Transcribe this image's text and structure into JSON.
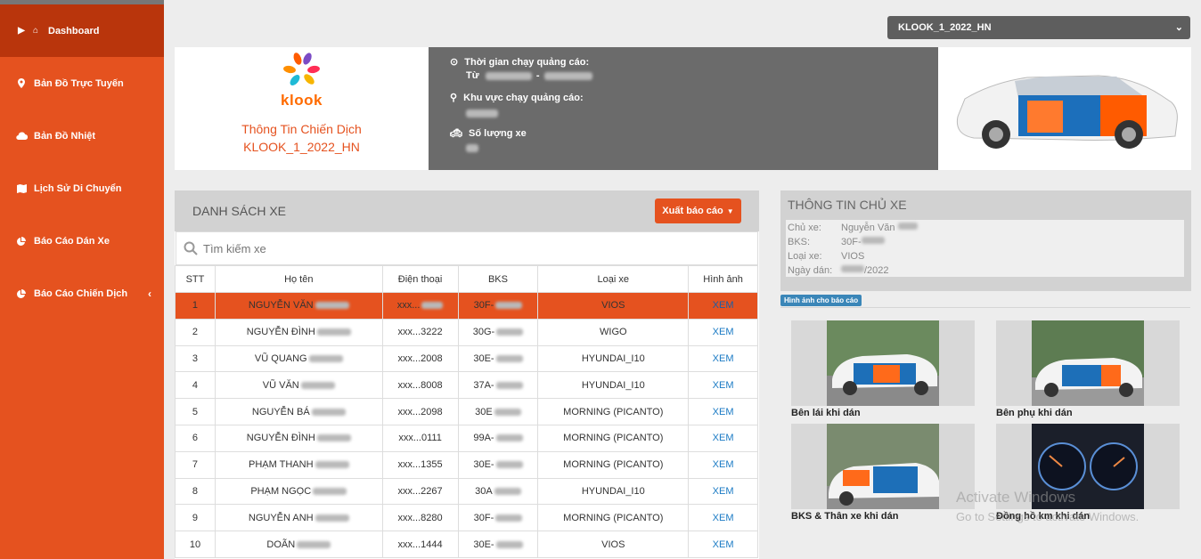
{
  "sidebar": {
    "items": [
      {
        "label": "Dashboard",
        "icon": "home-icon"
      },
      {
        "label": "Bản Đồ Trực Tuyến",
        "icon": "map-marker-icon"
      },
      {
        "label": "Bản Đồ Nhiệt",
        "icon": "cloud-icon"
      },
      {
        "label": "Lịch Sử Di Chuyển",
        "icon": "map-icon"
      },
      {
        "label": "Báo Cáo Dán Xe",
        "icon": "pie-chart-icon"
      },
      {
        "label": "Báo Cáo Chiến Dịch",
        "icon": "pie-chart-icon"
      }
    ]
  },
  "campaign_select": {
    "value": "KLOOK_1_2022_HN"
  },
  "banner": {
    "logo_text": "klook",
    "title_line1": "Thông Tin Chiến Dịch",
    "title_line2": "KLOOK_1_2022_HN",
    "time_label": "Thời gian chạy quảng cáo:",
    "from_label": "Từ",
    "dash": "-",
    "area_label": "Khu vực chạy quảng cáo:",
    "cars_label": "Số lượng xe"
  },
  "list": {
    "title": "DANH SÁCH XE",
    "export_label": "Xuất báo cáo",
    "search_placeholder": "Tìm kiếm xe",
    "columns": [
      "STT",
      "Họ tên",
      "Điện thoại",
      "BKS",
      "Loại xe",
      "Hình ảnh"
    ],
    "rows": [
      {
        "stt": "1",
        "name": "NGUYỄN VĂN",
        "phone": "xxx...",
        "bks": "30F-",
        "type": "VIOS",
        "img": "XEM"
      },
      {
        "stt": "2",
        "name": "NGUYỄN ĐÌNH",
        "phone": "xxx...3222",
        "bks": "30G-",
        "type": "WIGO",
        "img": "XEM"
      },
      {
        "stt": "3",
        "name": "VŨ QUANG",
        "phone": "xxx...2008",
        "bks": "30E-",
        "type": "HYUNDAI_I10",
        "img": "XEM"
      },
      {
        "stt": "4",
        "name": "VŨ VĂN",
        "phone": "xxx...8008",
        "bks": "37A-",
        "type": "HYUNDAI_I10",
        "img": "XEM"
      },
      {
        "stt": "5",
        "name": "NGUYỄN BÁ",
        "phone": "xxx...2098",
        "bks": "30E",
        "type": "MORNING (PICANTO)",
        "img": "XEM"
      },
      {
        "stt": "6",
        "name": "NGUYỄN ĐÌNH",
        "phone": "xxx...0111",
        "bks": "99A-",
        "type": "MORNING (PICANTO)",
        "img": "XEM"
      },
      {
        "stt": "7",
        "name": "PHẠM THANH",
        "phone": "xxx...1355",
        "bks": "30E-",
        "type": "MORNING (PICANTO)",
        "img": "XEM"
      },
      {
        "stt": "8",
        "name": "PHẠM NGỌC",
        "phone": "xxx...2267",
        "bks": "30A",
        "type": "HYUNDAI_I10",
        "img": "XEM"
      },
      {
        "stt": "9",
        "name": "NGUYỄN ANH",
        "phone": "xxx...8280",
        "bks": "30F-",
        "type": "MORNING (PICANTO)",
        "img": "XEM"
      },
      {
        "stt": "10",
        "name": "DOÃN",
        "phone": "xxx...1444",
        "bks": "30E-",
        "type": "VIOS",
        "img": "XEM"
      }
    ]
  },
  "owner": {
    "title": "THÔNG TIN CHỦ XE",
    "fields": [
      {
        "key": "Chủ xe:",
        "value": "Nguyễn Văn"
      },
      {
        "key": "BKS:",
        "value": "30F-"
      },
      {
        "key": "Loại xe:",
        "value": "VIOS"
      },
      {
        "key": "Ngày dán:",
        "value": "/2022"
      }
    ]
  },
  "report_badge": "Hình ảnh cho báo cáo",
  "photos": [
    {
      "caption": "Bên lái khi dán"
    },
    {
      "caption": "Bên phụ khi dán"
    },
    {
      "caption": "BKS & Thân xe khi dán"
    },
    {
      "caption": "Đồng hồ km khi dán"
    }
  ],
  "watermark": {
    "line1": "Activate Windows",
    "line2": "Go to Settings to activate Windows."
  },
  "colors": {
    "accent": "#e5521f",
    "accent_dark": "#b9350c",
    "panel_gray": "#6b6b6b",
    "link": "#1a7ac4"
  }
}
